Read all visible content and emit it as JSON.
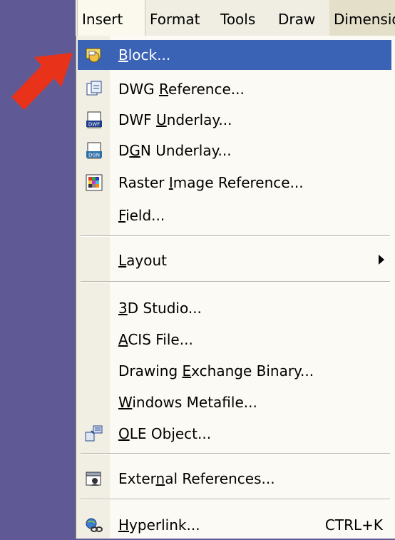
{
  "menubar": {
    "items": [
      "Insert",
      "Format",
      "Tools",
      "Draw",
      "Dimensio"
    ]
  },
  "menu": {
    "items": [
      {
        "pre": "",
        "mn": "B",
        "post": "lock...",
        "shortcut": "",
        "icon": "block-icon"
      },
      {
        "pre": "DWG ",
        "mn": "R",
        "post": "eference...",
        "shortcut": "",
        "icon": "dwg-reference-icon"
      },
      {
        "pre": "DWF ",
        "mn": "U",
        "post": "nderlay...",
        "shortcut": "",
        "icon": "dwf-underlay-icon"
      },
      {
        "pre": "D",
        "mn": "G",
        "post": "N Underlay...",
        "shortcut": "",
        "icon": "dgn-underlay-icon"
      },
      {
        "pre": "Raster ",
        "mn": "I",
        "post": "mage Reference...",
        "shortcut": "",
        "icon": "raster-image-icon"
      },
      {
        "pre": "",
        "mn": "F",
        "post": "ield...",
        "shortcut": "",
        "icon": ""
      },
      {
        "pre": "",
        "mn": "L",
        "post": "ayout",
        "shortcut": "",
        "icon": ""
      },
      {
        "pre": "",
        "mn": "3",
        "post": "D Studio...",
        "shortcut": "",
        "icon": ""
      },
      {
        "pre": "",
        "mn": "A",
        "post": "CIS File...",
        "shortcut": "",
        "icon": ""
      },
      {
        "pre": "Drawing ",
        "mn": "E",
        "post": "xchange Binary...",
        "shortcut": "",
        "icon": ""
      },
      {
        "pre": "",
        "mn": "W",
        "post": "indows Metafile...",
        "shortcut": "",
        "icon": ""
      },
      {
        "pre": "",
        "mn": "O",
        "post": "LE Object...",
        "shortcut": "",
        "icon": "ole-object-icon"
      },
      {
        "pre": "Exter",
        "mn": "n",
        "post": "al References...",
        "shortcut": "",
        "icon": "external-references-icon"
      },
      {
        "pre": "",
        "mn": "H",
        "post": "yperlink...",
        "shortcut": "CTRL+K",
        "icon": "hyperlink-icon"
      }
    ]
  },
  "colors": {
    "background": "#5f5a95",
    "selection": "#3a62b5",
    "arrow": "#e8321a",
    "menu": "#fbfaf4"
  }
}
